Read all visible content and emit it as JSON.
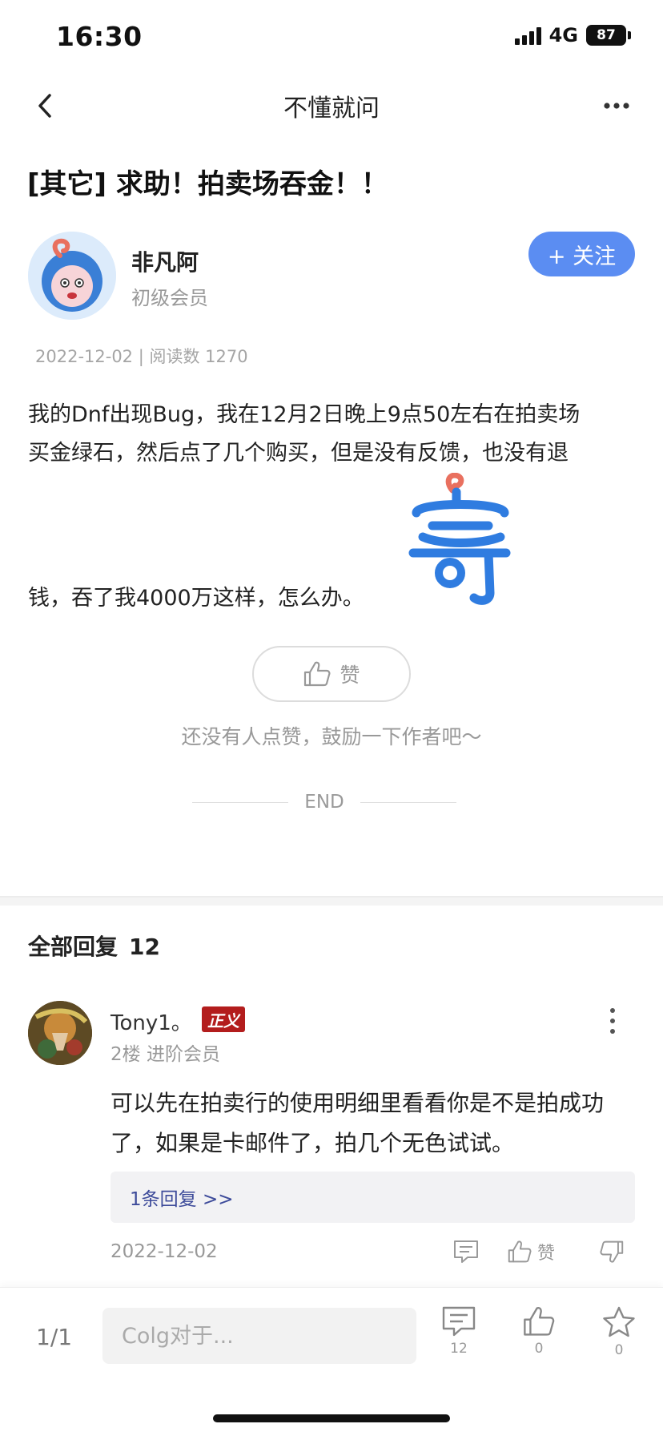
{
  "status_bar": {
    "time": "16:30",
    "network": "4G",
    "battery": "87"
  },
  "nav": {
    "title": "不懂就问"
  },
  "post": {
    "title": "[其它] 求助！拍卖场吞金！！",
    "author": {
      "name": "非凡阿",
      "level": "初级会员"
    },
    "follow_label": "+ 关注",
    "meta": "2022-12-02 | 阅读数 1270",
    "body_line1": "我的Dnf出现Bug，我在12月2日晚上9点50左右在拍卖场",
    "body_line2": "买金绿石，然后点了几个购买，但是没有反馈，也没有退",
    "body_line3": "钱，吞了我4000万这样，怎么办。",
    "like_label": "赞",
    "like_hint": "还没有人点赞，鼓励一下作者吧～",
    "end_label": "END"
  },
  "replies": {
    "heading": "全部回复",
    "count": "12",
    "items": [
      {
        "name": "Tony1。",
        "badge": "正义",
        "meta": "2楼 进阶会员",
        "content": "可以先在拍卖行的使用明细里看看你是不是拍成功了，如果是卡邮件了，拍几个无色试试。",
        "sub_replies": "1条回复 >>",
        "date": "2022-12-02",
        "like_label": "赞"
      }
    ]
  },
  "bottom_bar": {
    "page": "1/1",
    "input_placeholder": "Colg对于...",
    "comments_count": "12",
    "likes_count": "0",
    "favorites_count": "0"
  }
}
